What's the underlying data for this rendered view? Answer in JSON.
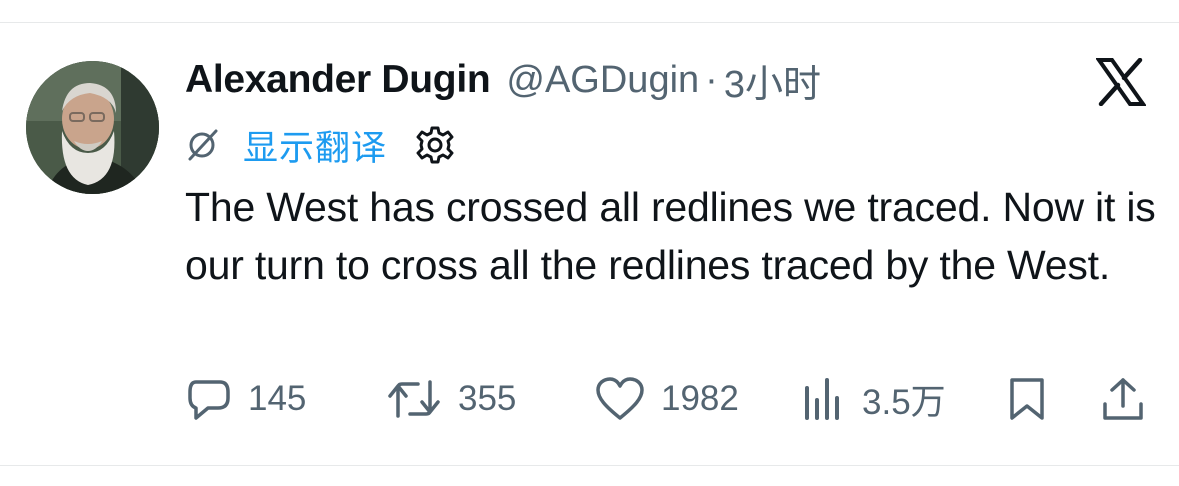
{
  "tweet": {
    "author": {
      "display_name": "Alexander Dugin",
      "handle": "@AGDugin"
    },
    "separator": "·",
    "timestamp": "3小时",
    "translate_label": "显示翻译",
    "text": "The West has crossed all redlines we traced. Now it is our turn to cross all the redlines traced by the West.",
    "metrics": {
      "replies": "145",
      "retweets": "355",
      "likes": "1982",
      "views": "3.5万"
    }
  },
  "icons": {
    "brand": "x-logo-icon",
    "translate": "translate-slash-icon",
    "settings": "gear-icon",
    "reply": "speech-bubble-icon",
    "retweet": "retweet-arrows-icon",
    "like": "heart-icon",
    "views": "bar-chart-icon",
    "bookmark": "bookmark-icon",
    "share": "upload-icon"
  },
  "colors": {
    "link": "#1d9bf0",
    "secondary_text": "#536471",
    "primary_text": "#0f1419",
    "divider": "#e7e9ea"
  }
}
